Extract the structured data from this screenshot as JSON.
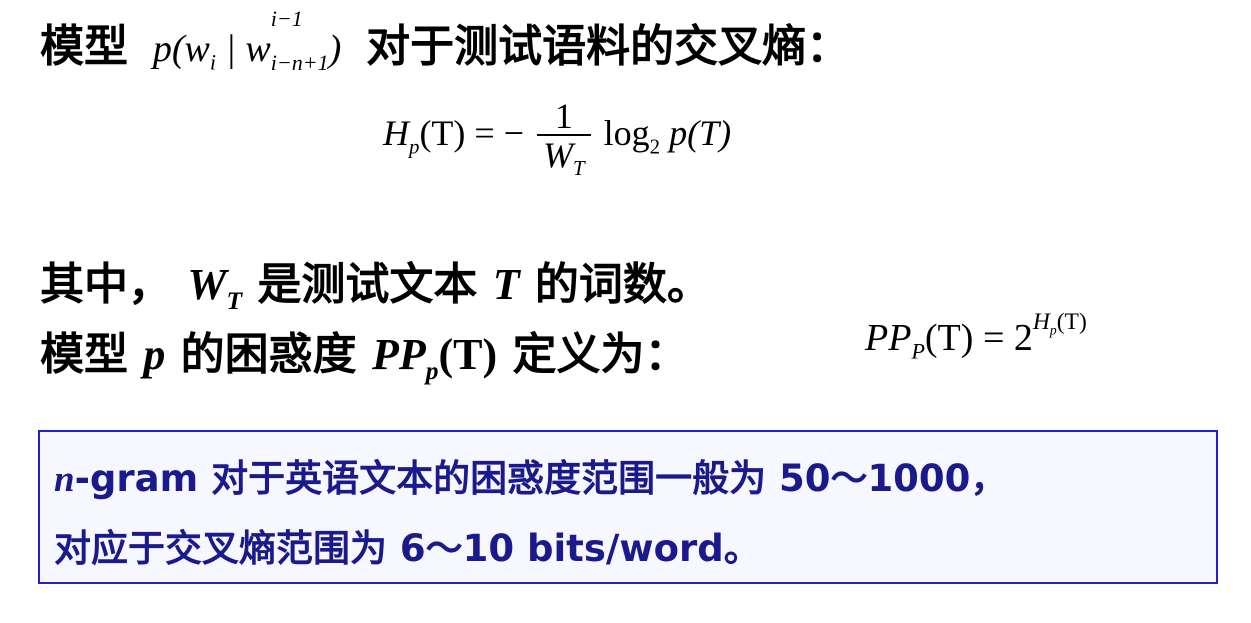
{
  "line1": {
    "prefix": "模型",
    "model_expr": "p(wᵢ | wᵢ₋ₙ₊₁ⁱ⁻¹)",
    "suffix": "对于测试语料的交叉熵："
  },
  "formula1": {
    "lhs": "H",
    "lhs_sub": "p",
    "lhs_arg": "(T)",
    "equals": "= −",
    "numerator": "1",
    "denominator": "W",
    "denominator_sub": "T",
    "log": "log",
    "log_base": "2",
    "rhs": "p(T)"
  },
  "line2": {
    "part1": "其中，",
    "var": "W",
    "var_sub": "T",
    "part2": "是测试文本",
    "var2": "T",
    "part3": "的词数。"
  },
  "line3": {
    "part1": "模型",
    "var": "p",
    "part2": "的困惑度",
    "pp": "PP",
    "pp_sub": "p",
    "pp_arg": "(T)",
    "part3": "定义为："
  },
  "formula2": {
    "lhs": "PP",
    "lhs_sub": "P",
    "lhs_arg": "(T)",
    "equals": "= 2",
    "exp": "H",
    "exp_sub": "p",
    "exp_arg": "(T)"
  },
  "note": {
    "line1_n": "n",
    "line1_text": "-gram 对于英语文本的困惑度范围一般为 50～1000，",
    "line2_text": "对应于交叉熵范围为 6～10 bits/word。"
  },
  "colors": {
    "note_border": "#2222cc",
    "note_text": "#1a1a8c"
  }
}
